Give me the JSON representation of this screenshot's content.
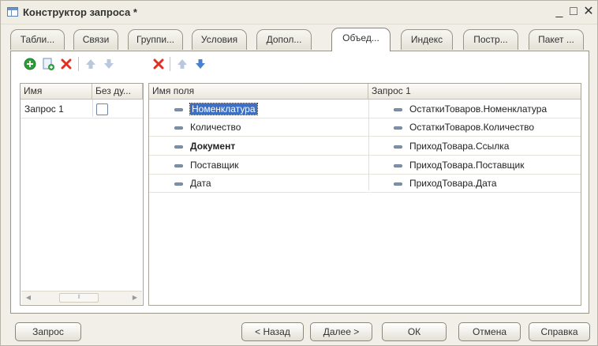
{
  "window": {
    "title": "Конструктор запроса *",
    "minimize_glyph": "_",
    "maximize_glyph": "□",
    "close_glyph": "✕"
  },
  "tabs": [
    {
      "label": "Табли...",
      "active": false
    },
    {
      "label": "Связи",
      "active": false
    },
    {
      "label": "Группи...",
      "active": false
    },
    {
      "label": "Условия",
      "active": false
    },
    {
      "label": "Допол...",
      "active": false
    },
    {
      "label": "Объед...",
      "active": true
    },
    {
      "label": "Индекс",
      "active": false
    },
    {
      "label": "Постр...",
      "active": false
    },
    {
      "label": "Пакет ...",
      "active": false
    }
  ],
  "toolbar": {
    "left": [
      "add-icon",
      "copy-icon",
      "delete-icon",
      "move-up-icon",
      "move-down-icon"
    ],
    "right": [
      "delete-icon",
      "move-up-icon",
      "move-down-icon"
    ]
  },
  "queries_table": {
    "columns": [
      "Имя",
      "Без ду..."
    ],
    "rows": [
      {
        "name": "Запрос 1",
        "no_duplicates": false
      }
    ]
  },
  "fields_table": {
    "columns": [
      "Имя поля",
      "Запрос 1"
    ],
    "rows": [
      {
        "field": "Номенклатура",
        "source": "ОстаткиТоваров.Номенклатура",
        "selected": true,
        "bold": false
      },
      {
        "field": "Количество",
        "source": "ОстаткиТоваров.Количество",
        "selected": false,
        "bold": false
      },
      {
        "field": "Документ",
        "source": "ПриходТовара.Ссылка",
        "selected": false,
        "bold": true
      },
      {
        "field": "Поставщик",
        "source": "ПриходТовара.Поставщик",
        "selected": false,
        "bold": false
      },
      {
        "field": "Дата",
        "source": "ПриходТовара.Дата",
        "selected": false,
        "bold": false
      }
    ]
  },
  "buttons": {
    "query": "Запрос",
    "back": "< Назад",
    "next": "Далее >",
    "ok": "ОК",
    "cancel": "Отмена",
    "help": "Справка"
  },
  "colors": {
    "selection": "#3d6fc4",
    "add_green": "#2e9d3a",
    "delete_red": "#e03020",
    "arrow_blue": "#4a7fd0",
    "arrow_disabled": "#b9c8de"
  }
}
